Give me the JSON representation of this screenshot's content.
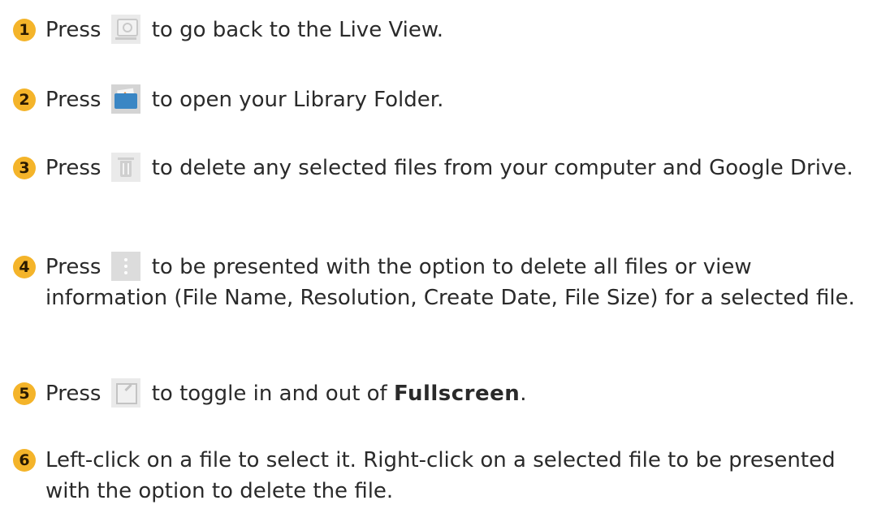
{
  "steps": [
    {
      "number": "1",
      "before": "Press",
      "icon": "live-view-icon",
      "after": "to go back to the Live View."
    },
    {
      "number": "2",
      "before": "Press",
      "icon": "library-folder-icon",
      "after": "to open your Library Folder."
    },
    {
      "number": "3",
      "before": "Press",
      "icon": "trash-icon",
      "after": "to delete any selected files from your computer and Google Drive."
    },
    {
      "number": "4",
      "before": "Press",
      "icon": "more-options-icon",
      "after": "to be presented with the option to delete all files or view information (File Name, Resolution, Create Date, File Size) for a selected file."
    },
    {
      "number": "5",
      "before": "Press",
      "icon": "fullscreen-icon",
      "after": "to toggle in and out of",
      "emphasis": "Fullscreen",
      "end": "."
    },
    {
      "number": "6",
      "text": "Left-click on a file to select it. Right-click on a selected file to be presented with the option to delete the file."
    }
  ],
  "colors": {
    "badge": "#f4b42a",
    "text": "#2a2a2a"
  }
}
